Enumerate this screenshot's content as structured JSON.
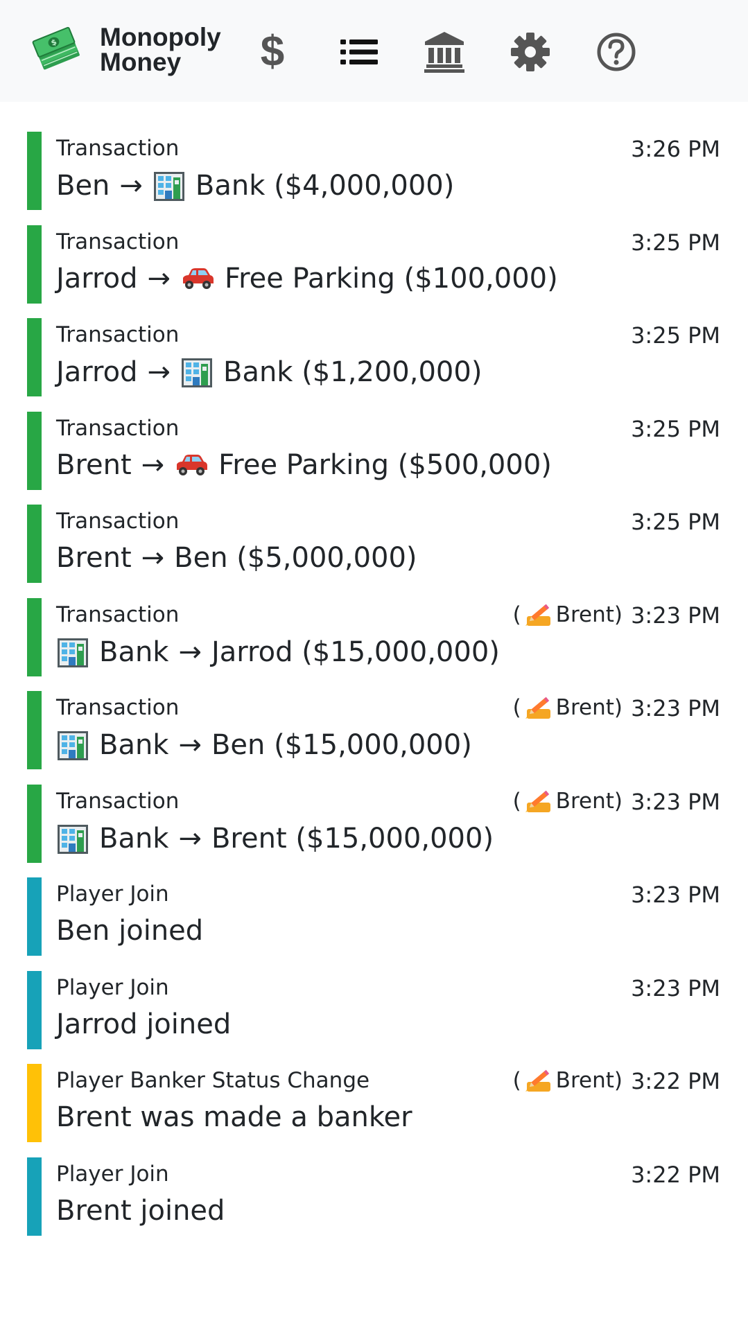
{
  "app": {
    "brand_name": "Monopoly\nMoney"
  },
  "nav": {
    "items": [
      {
        "name": "dollar-icon"
      },
      {
        "name": "list-icon"
      },
      {
        "name": "bank-icon"
      },
      {
        "name": "gear-icon"
      },
      {
        "name": "help-icon"
      }
    ],
    "active": "list-icon"
  },
  "colors": {
    "transaction": "#28a745",
    "player_join": "#17a2b8",
    "status_change": "#ffc107",
    "navbar_bg": "#f8f9fa",
    "icon_gray": "#555555"
  },
  "history": [
    {
      "type": "Transaction",
      "time": "3:26 PM",
      "actor": "",
      "from": "Ben",
      "from_icon": "",
      "arrow": "→",
      "to": "Bank",
      "to_icon": "bank",
      "amount": "($4,000,000)"
    },
    {
      "type": "Transaction",
      "time": "3:25 PM",
      "actor": "",
      "from": "Jarrod",
      "from_icon": "",
      "arrow": "→",
      "to": "Free Parking",
      "to_icon": "car",
      "amount": "($100,000)"
    },
    {
      "type": "Transaction",
      "time": "3:25 PM",
      "actor": "",
      "from": "Jarrod",
      "from_icon": "",
      "arrow": "→",
      "to": "Bank",
      "to_icon": "bank",
      "amount": "($1,200,000)"
    },
    {
      "type": "Transaction",
      "time": "3:25 PM",
      "actor": "",
      "from": "Brent",
      "from_icon": "",
      "arrow": "→",
      "to": "Free Parking",
      "to_icon": "car",
      "amount": "($500,000)"
    },
    {
      "type": "Transaction",
      "time": "3:25 PM",
      "actor": "",
      "from": "Brent",
      "from_icon": "",
      "arrow": "→",
      "to": "Ben",
      "to_icon": "",
      "amount": "($5,000,000)"
    },
    {
      "type": "Transaction",
      "time": "3:23 PM",
      "actor": "Brent",
      "from": "Bank",
      "from_icon": "bank",
      "arrow": "→",
      "to": "Jarrod",
      "to_icon": "",
      "amount": "($15,000,000)"
    },
    {
      "type": "Transaction",
      "time": "3:23 PM",
      "actor": "Brent",
      "from": "Bank",
      "from_icon": "bank",
      "arrow": "→",
      "to": "Ben",
      "to_icon": "",
      "amount": "($15,000,000)"
    },
    {
      "type": "Transaction",
      "time": "3:23 PM",
      "actor": "Brent",
      "from": "Bank",
      "from_icon": "bank",
      "arrow": "→",
      "to": "Brent",
      "to_icon": "",
      "amount": "($15,000,000)"
    },
    {
      "type": "Player Join",
      "time": "3:23 PM",
      "actor": "",
      "text": "Ben joined"
    },
    {
      "type": "Player Join",
      "time": "3:23 PM",
      "actor": "",
      "text": "Jarrod joined"
    },
    {
      "type": "Player Banker Status Change",
      "time": "3:22 PM",
      "actor": "Brent",
      "text": "Brent was made a banker"
    },
    {
      "type": "Player Join",
      "time": "3:22 PM",
      "actor": "",
      "text": "Brent joined"
    }
  ]
}
